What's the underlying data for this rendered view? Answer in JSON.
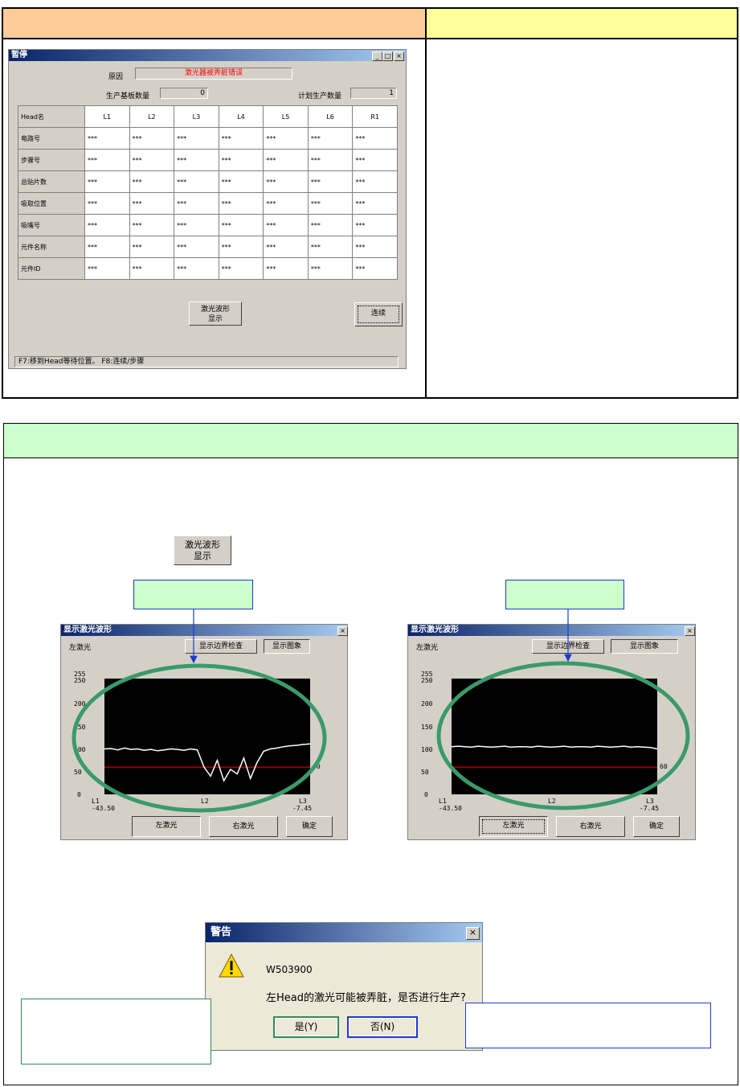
{
  "pause_dialog": {
    "title": "暂停",
    "reason_label": "原因",
    "reason_value": "激光器被弄脏错误",
    "produced_label": "生产基板数量",
    "produced_value": "0",
    "planned_label": "计划生产数量",
    "planned_value": "1",
    "table": {
      "header": [
        "Head名",
        "L1",
        "L2",
        "L3",
        "L4",
        "L5",
        "L6",
        "R1"
      ],
      "rows": [
        {
          "label": "电路号",
          "cells": [
            "***",
            "***",
            "***",
            "***",
            "***",
            "***",
            "***"
          ]
        },
        {
          "label": "步骤号",
          "cells": [
            "***",
            "***",
            "***",
            "***",
            "***",
            "***",
            "***"
          ]
        },
        {
          "label": "总贴片数",
          "cells": [
            "***",
            "***",
            "***",
            "***",
            "***",
            "***",
            "***"
          ]
        },
        {
          "label": "吸取位置",
          "cells": [
            "***",
            "***",
            "***",
            "***",
            "***",
            "***",
            "***"
          ]
        },
        {
          "label": "吸嘴号",
          "cells": [
            "***",
            "***",
            "***",
            "***",
            "***",
            "***",
            "***"
          ]
        },
        {
          "label": "元件名称",
          "cells": [
            "***",
            "***",
            "***",
            "***",
            "***",
            "***",
            "***"
          ]
        },
        {
          "label": "元件ID",
          "cells": [
            "***",
            "***",
            "***",
            "***",
            "***",
            "***",
            "***"
          ]
        }
      ]
    },
    "laser_btn_line1": "激光波形",
    "laser_btn_line2": "显示",
    "continue_btn": "连续",
    "status_text": "F7:移到Head等待位置。 F8:连续/步骤"
  },
  "laser_button": {
    "line1": "激光波形",
    "line2": "显示"
  },
  "waveform_left": {
    "title": "显示激光波形",
    "side_label": "左激光",
    "btn_boundary": "显示边界检查",
    "btn_image": "显示图象",
    "btn_left": "左激光",
    "btn_right": "右激光",
    "btn_ok": "确定"
  },
  "waveform_right": {
    "title": "显示激光波形",
    "side_label": "左激光",
    "btn_boundary": "显示边界检查",
    "btn_image": "显示图象",
    "btn_left": "左激光",
    "btn_right": "右激光",
    "btn_ok": "确定"
  },
  "chart_axes": {
    "y_ticks": [
      "255",
      "250",
      "200",
      "150",
      "100",
      "50",
      "0"
    ],
    "threshold_label": "60",
    "x_l1": "L1",
    "x_l1_val": "-43.50",
    "x_l2": "L2",
    "x_l3": "L3",
    "x_l3_val": "-7.45"
  },
  "chart_data": [
    {
      "type": "line",
      "title": "",
      "ylim": [
        0,
        255
      ],
      "threshold": 60,
      "x_labels": [
        "L1",
        "L2",
        "L3"
      ],
      "x_range": [
        -43.5,
        -7.45
      ],
      "series": [
        {
          "values": [
            100,
            101,
            98,
            102,
            99,
            100,
            97,
            99,
            96,
            98,
            100,
            99,
            97,
            100,
            98,
            60,
            40,
            75,
            30,
            55,
            45,
            80,
            35,
            70,
            95,
            100,
            102,
            105,
            107,
            108,
            110,
            111
          ]
        }
      ],
      "grid": false
    },
    {
      "type": "line",
      "title": "",
      "ylim": [
        0,
        255
      ],
      "threshold": 60,
      "x_labels": [
        "L1",
        "L2",
        "L3"
      ],
      "x_range": [
        -43.5,
        -7.45
      ],
      "series": [
        {
          "values": [
            105,
            106,
            105,
            104,
            106,
            105,
            104,
            105,
            106,
            104,
            105,
            105,
            104,
            106,
            105,
            104,
            105,
            106,
            104,
            105,
            105,
            104,
            106,
            105,
            104,
            105,
            106,
            104,
            105,
            104,
            103,
            100
          ]
        }
      ],
      "grid": false
    }
  ],
  "warning_dialog": {
    "title": "警告",
    "code": "W503900",
    "message": "左Head的激光可能被弄脏，是否进行生产?",
    "yes": "是(Y)",
    "no": "否(N)"
  },
  "colors": {
    "orange_header": "#ffcc99",
    "yellow_header": "#ffff99",
    "green_header": "#ccffcc",
    "ellipse": "#2e8b57",
    "threshold": "#ff0000"
  }
}
